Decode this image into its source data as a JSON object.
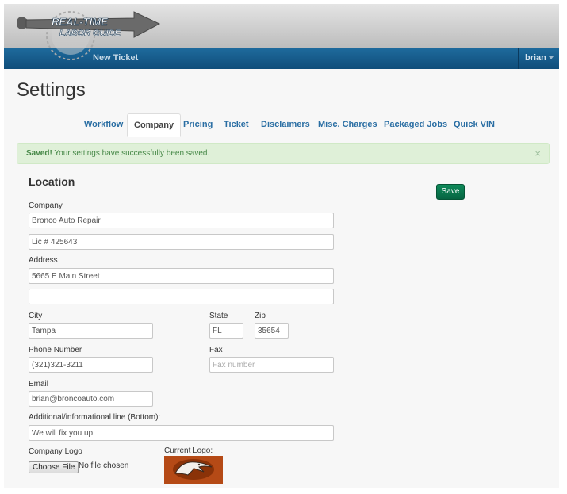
{
  "header": {
    "logo_text_top": "REAL-TIME",
    "logo_text_bottom": "LABOR GUIDE",
    "nav_link": "New Ticket",
    "user": "brian"
  },
  "page": {
    "title": "Settings"
  },
  "tabs": [
    {
      "label": "Workflow",
      "active": false
    },
    {
      "label": "Company",
      "active": true
    },
    {
      "label": "Pricing",
      "active": false
    },
    {
      "label": "Ticket",
      "active": false
    },
    {
      "label": "Disclaimers",
      "active": false
    },
    {
      "label": "Misc. Charges",
      "active": false
    },
    {
      "label": "Packaged Jobs",
      "active": false
    },
    {
      "label": "Quick VIN",
      "active": false
    }
  ],
  "alert": {
    "strong": "Saved!",
    "message": " Your settings have successfully been saved.",
    "close": "×"
  },
  "section": {
    "title": "Location",
    "save_label": "Save"
  },
  "form": {
    "company_label": "Company",
    "company_value": "Bronco Auto Repair",
    "license_value": "Lic # 425643",
    "address_label": "Address",
    "address1_value": "5665 E Main Street",
    "address2_value": "",
    "city_label": "City",
    "city_value": "Tampa",
    "state_label": "State",
    "state_value": "FL",
    "zip_label": "Zip",
    "zip_value": "35654",
    "phone_label": "Phone Number",
    "phone_value": "(321)321-3211",
    "fax_label": "Fax",
    "fax_placeholder": "Fax number",
    "email_label": "Email",
    "email_value": "brian@broncoauto.com",
    "addl_label": "Additional/informational line (Bottom):",
    "addl_value": "We will fix you up!",
    "logo_label": "Company Logo",
    "choose_file": "Choose File",
    "no_file": "No file chosen",
    "current_logo_label": "Current Logo:"
  },
  "colors": {
    "navbar": "#1e6a9c",
    "tab_link": "#2a6ea3",
    "alert_bg": "#dff0d8",
    "alert_text": "#468847",
    "save_btn": "#0f8a5a",
    "logo_bg": "#b54a16"
  }
}
